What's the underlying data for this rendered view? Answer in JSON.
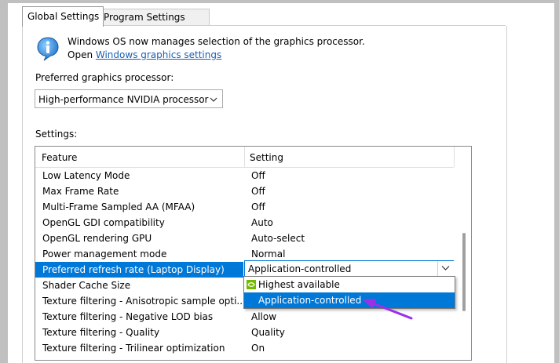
{
  "tabs": [
    {
      "label": "Global Settings",
      "active": true
    },
    {
      "label": "Program Settings",
      "active": false
    }
  ],
  "info": {
    "line1": "Windows OS now manages selection of the graphics processor.",
    "line2_prefix": "Open ",
    "link_text": "Windows graphics settings",
    "icon": "info-icon"
  },
  "preferred_gpu": {
    "label": "Preferred graphics processor:",
    "value": "High-performance NVIDIA processor"
  },
  "settings": {
    "label": "Settings:",
    "columns": {
      "feature": "Feature",
      "setting": "Setting"
    },
    "rows": [
      {
        "feature": "Low Latency Mode",
        "setting": "Off"
      },
      {
        "feature": "Max Frame Rate",
        "setting": "Off"
      },
      {
        "feature": "Multi-Frame Sampled AA (MFAA)",
        "setting": "Off"
      },
      {
        "feature": "OpenGL GDI compatibility",
        "setting": "Auto"
      },
      {
        "feature": "OpenGL rendering GPU",
        "setting": "Auto-select"
      },
      {
        "feature": "Power management mode",
        "setting": "Normal"
      },
      {
        "feature": "Preferred refresh rate (Laptop Display)",
        "setting": "Application-controlled",
        "selected": true
      },
      {
        "feature": "Shader Cache Size",
        "setting": ""
      },
      {
        "feature": "Texture filtering - Anisotropic sample opti...",
        "setting": ""
      },
      {
        "feature": "Texture filtering - Negative LOD bias",
        "setting": "Allow"
      },
      {
        "feature": "Texture filtering - Quality",
        "setting": "Quality"
      },
      {
        "feature": "Texture filtering - Trilinear optimization",
        "setting": "On"
      }
    ]
  },
  "dropdown": {
    "options": [
      {
        "label": "Highest available",
        "icon": "nvidia-icon"
      },
      {
        "label": "Application-controlled",
        "highlighted": true
      }
    ]
  },
  "colors": {
    "selection": "#0078d7",
    "link": "#1a5fb4",
    "arrow": "#9b30e8"
  }
}
